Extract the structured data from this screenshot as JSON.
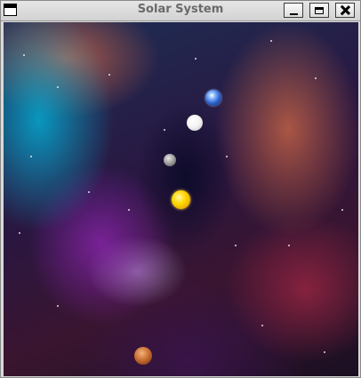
{
  "window": {
    "title": "Solar System",
    "menu_icon": "window-menu-icon",
    "buttons": {
      "minimize": "minimize-icon",
      "maximize": "maximize-icon",
      "close": "close-icon"
    }
  },
  "scene": {
    "background": "nebula-space-background",
    "planets": [
      {
        "name": "earth",
        "color": "#3b6fd6"
      },
      {
        "name": "white-planet",
        "color": "#f2f2f2"
      },
      {
        "name": "gray-moon",
        "color": "#9a9a9a"
      },
      {
        "name": "sun",
        "color": "#f5c400"
      },
      {
        "name": "mars",
        "color": "#c46a2e"
      }
    ]
  }
}
